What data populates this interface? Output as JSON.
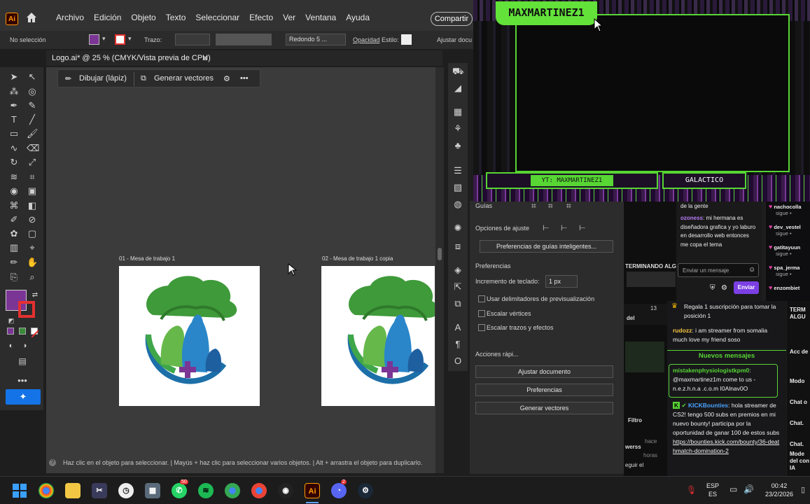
{
  "illustrator": {
    "app_logo": "Ai",
    "menu": [
      "Archivo",
      "Edición",
      "Objeto",
      "Texto",
      "Seleccionar",
      "Efecto",
      "Ver",
      "Ventana",
      "Ayuda"
    ],
    "share_label": "Compartir",
    "control_bar": {
      "selection": "No selección",
      "stroke_label": "Trazo:",
      "brush_value": "Redondo 5 ...",
      "opacity_label": "Opacidad",
      "style_label": "Estilo:",
      "adjust_label": "Ajustar docu",
      "fill_color": "#7b3595",
      "stroke_color": "#e53030"
    },
    "document_tab": "Logo.ai* @ 25 % (CMYK/Vista previa de CPU)",
    "context_bar": {
      "draw_label": "Dibujar (lápiz)",
      "vectorize_label": "Generar vectores",
      "more_label": "•••"
    },
    "artboards": [
      {
        "label": "01 - Mesa de trabajo 1"
      },
      {
        "label": "02 - Mesa de trabajo 1 copia"
      }
    ],
    "status_text": "Haz clic en el objeto para seleccionar.  |  Mayús + haz clic para seleccionar varios objetos.  |  Alt + arrastra el objeto para duplicarlo.",
    "panel": {
      "guides_title": "Guías",
      "snap_options": "Opciones de ajuste",
      "smart_guides_button": "Preferencias de guías inteligentes...",
      "preferences_title": "Preferencias",
      "keyboard_increment_label": "Incremento de teclado:",
      "keyboard_increment_value": "1 px",
      "checkboxes": [
        "Usar delimitadores de previsualización",
        "Escalar vértices",
        "Escalar trazos y efectos"
      ],
      "quick_actions_title": "Acciones rápi...",
      "buttons": [
        "Ajustar documento",
        "Preferencias",
        "Generar vectores"
      ]
    },
    "toolbar_more": "•••"
  },
  "stream": {
    "streamer_name": "MAXMARTINEZ1",
    "yt_label": "YT: MAXMARTINEZ1",
    "tag_label": "GALACTICO",
    "accent": "#57d634"
  },
  "chat_top": {
    "line1": "de la gente",
    "author": "ozoness",
    "message": "mi hermana es diseñadora grafica y yo laburo en desarrollo web entonces me copa el tema",
    "input_placeholder": "Enviar un mensaje",
    "send_label": "Enviar"
  },
  "followers": [
    {
      "name": "nachocolla",
      "action": "sigue •"
    },
    {
      "name": "dev_vestel",
      "action": "sigue •"
    },
    {
      "name": "gatitayuun",
      "action": "sigue •"
    },
    {
      "name": "spa_jerma",
      "action": "sigue •"
    },
    {
      "name": "enzombiet",
      "action": ""
    }
  ],
  "dark_strip": {
    "terminado": "TERMINANDO ALG",
    "del": "del",
    "filtro": "Filtro",
    "werss": "werss",
    "hace": "hace",
    "horas": "horas",
    "eguir": "eguir el",
    "counter": "13"
  },
  "chat_main": {
    "gift_text": "Regala 1 suscripción para tomar la posición 1",
    "msg1_author": "rudozz",
    "msg1_text": "i am streamer from somalia much love my friend soso",
    "new_messages": "Nuevos mensajes",
    "msg2_author": "mistakenphysiologistkpm0",
    "msg2_text": "@maxmartinez1m come to us - n.e.z.h.n.a .c.o.m I0Alnav0O",
    "msg3_author": "KICKBounties",
    "msg3_text": "hola streamer de CS2! tengo 500 subs en premios en mi nuevo bounty! participa por la oportunidad de ganar 100 de estos subs",
    "msg3_link": "https://bounties.kick.com/bounty/36-deathmatch-domination-2"
  },
  "right_col": [
    "TERM ALGU",
    "Acc de",
    "Modo",
    "Chat o",
    "Chat.",
    "Chat.",
    "Mode del con IA"
  ],
  "taskbar": {
    "whatsapp_badge": "50",
    "discord_badge": "2",
    "lang": "ESP",
    "lang_sub": "ES",
    "time": "00:42",
    "date": "23/2/2026"
  }
}
